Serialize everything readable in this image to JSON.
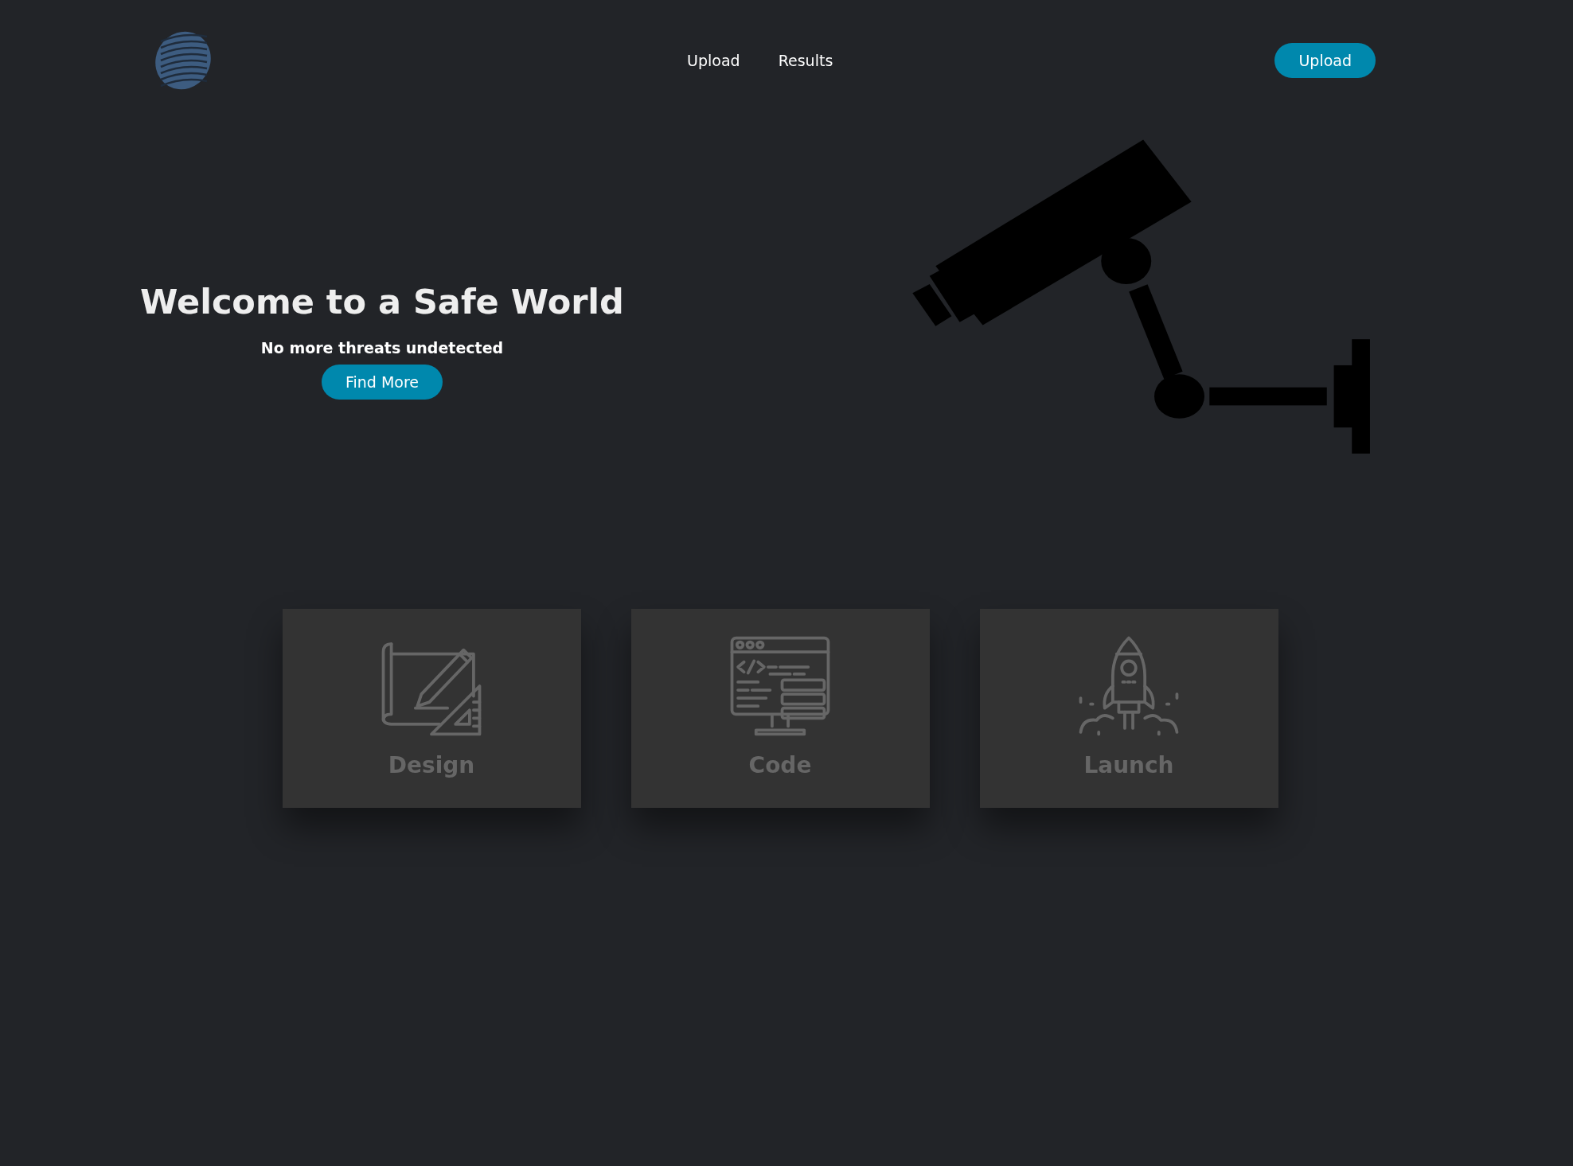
{
  "nav": {
    "links": [
      {
        "label": "Upload"
      },
      {
        "label": "Results"
      }
    ],
    "button": "Upload"
  },
  "hero": {
    "title": "Welcome to a Safe World",
    "subtitle": "No more threats undetected",
    "button": "Find More"
  },
  "cards": [
    {
      "kind": "design",
      "title": "Design"
    },
    {
      "kind": "code",
      "title": "Code"
    },
    {
      "kind": "launch",
      "title": "Launch"
    }
  ]
}
